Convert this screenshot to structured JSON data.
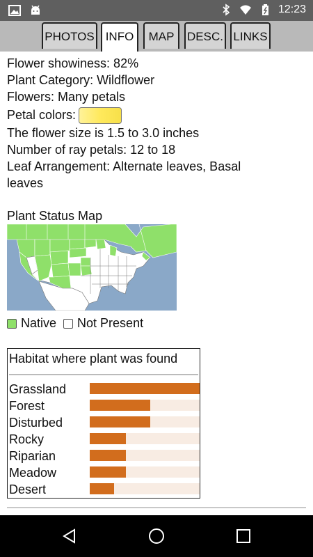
{
  "status_bar": {
    "time": "12:23",
    "icons": [
      "image-icon",
      "android-icon",
      "bluetooth-icon",
      "wifi-icon",
      "battery-icon"
    ]
  },
  "tabs": [
    {
      "label": "PHOTOS",
      "active": false
    },
    {
      "label": "INFO",
      "active": true
    },
    {
      "label": "MAP",
      "active": false
    },
    {
      "label": "DESC.",
      "active": false
    },
    {
      "label": "LINKS",
      "active": false
    }
  ],
  "info": {
    "showiness": "Flower showiness: 82%",
    "category": "Plant Category: Wildflower",
    "flowers": "Flowers: Many petals",
    "petal_colors_label": "Petal colors:",
    "petal_color": "#ffe95c",
    "size": "The flower size is 1.5 to 3.0 inches",
    "ray_petals": "Number of ray petals: 12 to 18",
    "leaf_line1": "Leaf Arrangement: Alternate leaves, Basal",
    "leaf_line2": "leaves"
  },
  "status_map": {
    "title": "Plant Status Map",
    "legend_native": "Native",
    "legend_not_present": "Not Present",
    "colors": {
      "native": "#8fe06a",
      "not_present": "#ffffff",
      "water": "#8aa8c8"
    }
  },
  "habitat": {
    "title": "Habitat where plant was found",
    "bar_color": "#d26d1d",
    "track_color": "#f8ece3",
    "items": [
      {
        "label": "Grassland",
        "value": 1.0
      },
      {
        "label": "Forest",
        "value": 0.55
      },
      {
        "label": "Disturbed",
        "value": 0.55
      },
      {
        "label": "Rocky",
        "value": 0.33
      },
      {
        "label": "Riparian",
        "value": 0.33
      },
      {
        "label": "Meadow",
        "value": 0.33
      },
      {
        "label": "Desert",
        "value": 0.22
      }
    ]
  },
  "nav_bar": {
    "buttons": [
      "back-icon",
      "home-icon",
      "recents-icon"
    ]
  }
}
